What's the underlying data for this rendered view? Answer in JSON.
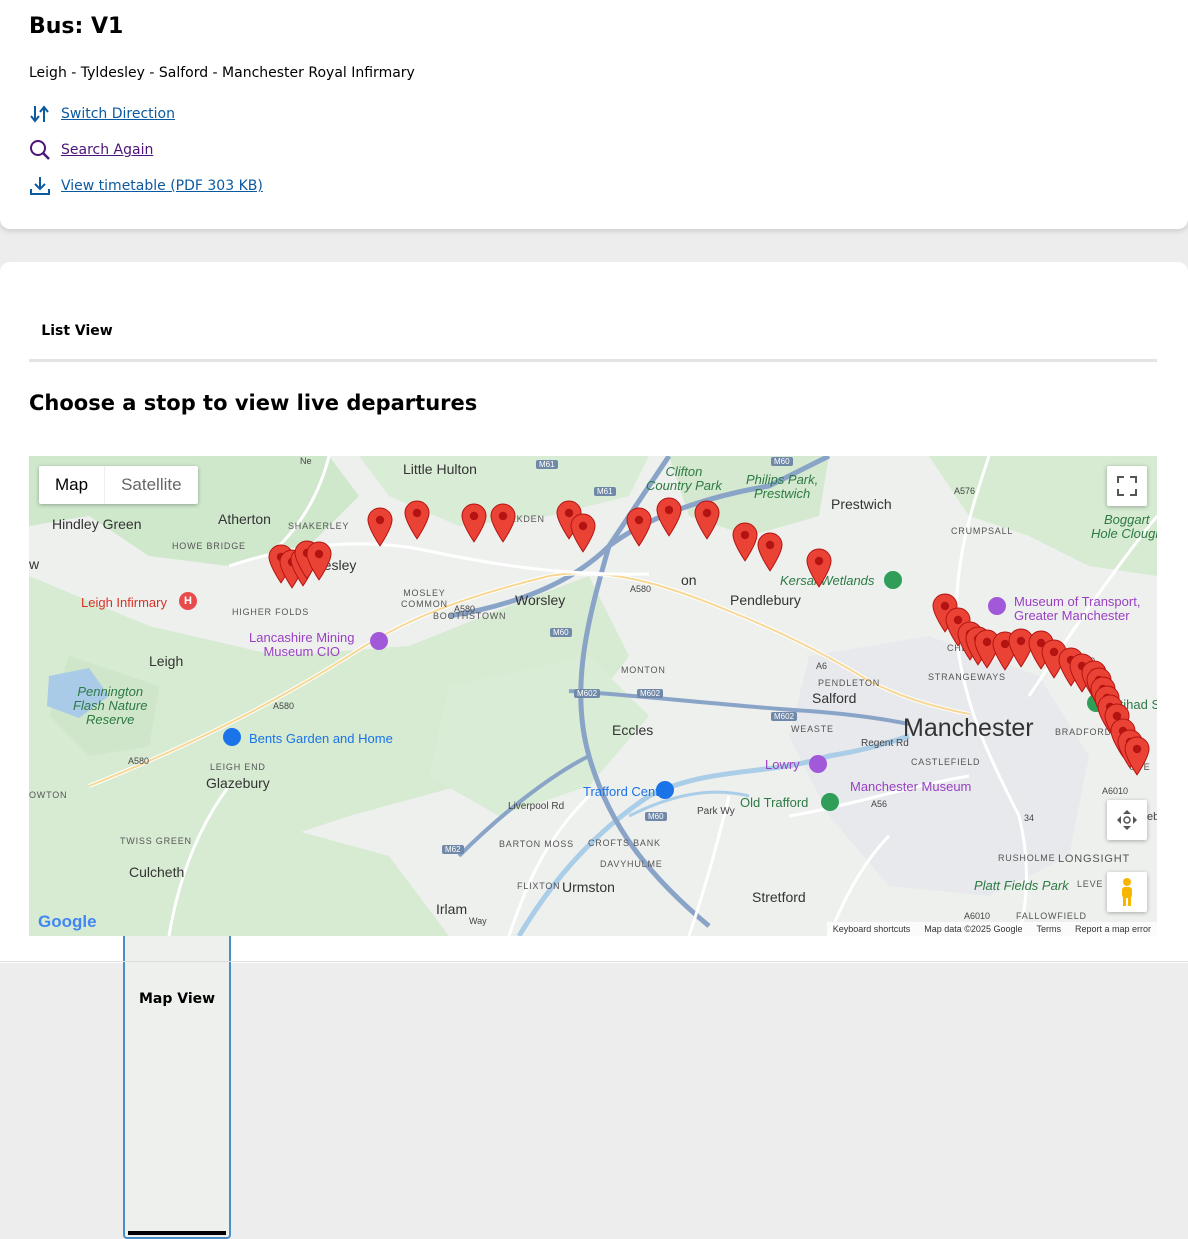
{
  "bus": {
    "title": "Bus: V1",
    "route": "Leigh - Tyldesley - Salford - Manchester Royal Infirmary"
  },
  "actions": {
    "switch": "Switch Direction",
    "search": "Search Again",
    "timetable": "View timetable (PDF 303 KB)"
  },
  "tabs": {
    "list": "List View",
    "map": "Map View",
    "active": "map"
  },
  "heading": "Choose a stop to view live departures",
  "colors": {
    "link": "#0b5aa0",
    "visited": "#4b1478",
    "pin": "#ea4335",
    "tab_focus": "#4a8ec8"
  },
  "map": {
    "type_controls": {
      "map": "Map",
      "satellite": "Satellite",
      "selected": "map"
    },
    "towns": {
      "little_hulton": "Little Hulton",
      "atherton": "Atherton",
      "hindley_green": "Hindley Green",
      "tyldesley": "Tyldesley",
      "worsley": "Worsley",
      "leigh": "Leigh",
      "glazebury": "Glazebury",
      "culcheth": "Culcheth",
      "eccles": "Eccles",
      "salford": "Salford",
      "manchester": "Manchester",
      "prestwich": "Prestwich",
      "pendlebury": "Pendlebury",
      "urmston": "Urmston",
      "irlam": "Irlam",
      "stretford": "Stretford",
      "on": "on",
      "w": "w"
    },
    "districts": {
      "shakerley": "SHAKERLEY",
      "howe_bridge": "HOWE BRIDGE",
      "higher_folds": "HIGHER FOLDS",
      "walkden": "WALKDEN",
      "mosley_common": "MOSLEY\nCOMMON",
      "boothstown": "BOOTHSTOWN",
      "monton": "MONTON",
      "crumpsall": "CRUMPSALL",
      "cheetham_hill": "CHEETHAM HILL",
      "strangeways": "STRANGEWAYS",
      "pendleton": "PENDLETON",
      "weaste": "WEASTE",
      "castlefield": "CASTLEFIELD",
      "bradford": "BRADFORD",
      "leigh_end": "LEIGH END",
      "twiss_green": "TWISS GREEN",
      "barton_moss": "BARTON MOSS",
      "crofts_bank": "CROFTS BANK",
      "davyhulme": "DAVYHULME",
      "flixton": "FLIXTON",
      "rusholme": "RUSHOLME",
      "longsight": "LONGSIGHT",
      "fallowfield": "FALLOWFIELD",
      "ope": "OPE",
      "owton": "OWTON",
      "leve": "LEVE"
    },
    "parks": {
      "clifton": "Clifton\nCountry Park",
      "philips": "Philips Park,\nPrestwich",
      "boggart": "Boggart\nHole Clough",
      "kersal": "Kersal Wetlands",
      "pennington": "Pennington\nFlash Nature\nReserve",
      "platt": "Platt Fields Park"
    },
    "pois": {
      "leigh_infirmary": "Leigh Infirmary",
      "lancashire_mining": "Lancashire Mining\nMuseum CIO",
      "museum_transport": "Museum of Transport,\nGreater Manchester",
      "bents": "Bents Garden and Home",
      "trafford_centre": "Trafford Centre",
      "lowry": "Lowry",
      "old_trafford": "Old Trafford",
      "manchester_museum": "Manchester Museum",
      "etihad": "Etihad S"
    },
    "roads": {
      "m61a": "M61",
      "m61b": "M61",
      "m60a": "M60",
      "m60b": "M60",
      "m60c": "M60",
      "m602a": "M602",
      "m602b": "M602",
      "m602c": "M602",
      "m62": "M62",
      "a580a": "A580",
      "a580b": "A580",
      "a580c": "A580",
      "a580d": "A580",
      "a6": "A6",
      "a56": "A56",
      "a6010a": "A6010",
      "a6010b": "A6010",
      "a576": "A576",
      "a6010c": "A6010",
      "liverpool_rd": "Liverpool Rd",
      "park_way": "Park Wy",
      "regent_rd": "Regent Rd",
      "ne": "Ne",
      "way": "Way",
      "b34": "34",
      "eb": "eb"
    },
    "attribution": {
      "shortcuts": "Keyboard shortcuts",
      "data": "Map data ©2025 Google",
      "terms": "Terms",
      "report": "Report a map error"
    },
    "logo": "Google",
    "stops": [
      {
        "lat": 53.4994,
        "lng": -2.5187
      },
      {
        "lat": 53.4978,
        "lng": -2.5145
      },
      {
        "lat": 53.4986,
        "lng": -2.51
      },
      {
        "lat": 53.5006,
        "lng": -2.5086
      },
      {
        "lat": 53.5001,
        "lng": -2.5039
      },
      {
        "lat": 53.5098,
        "lng": -2.4796
      },
      {
        "lat": 53.5119,
        "lng": -2.4654
      },
      {
        "lat": 53.5112,
        "lng": -2.4428
      },
      {
        "lat": 53.5112,
        "lng": -2.4313
      },
      {
        "lat": 53.512,
        "lng": -2.4053
      },
      {
        "lat": 53.5082,
        "lng": -2.3998
      },
      {
        "lat": 53.5099,
        "lng": -2.378
      },
      {
        "lat": 53.5127,
        "lng": -2.3661
      },
      {
        "lat": 53.5118,
        "lng": -2.3512
      },
      {
        "lat": 53.5055,
        "lng": -2.3364
      },
      {
        "lat": 53.5028,
        "lng": -2.3263
      },
      {
        "lat": 53.4981,
        "lng": -2.3072
      },
      {
        "lat": 53.4853,
        "lng": -2.2574
      },
      {
        "lat": 53.4814,
        "lng": -2.2525
      },
      {
        "lat": 53.4774,
        "lng": -2.2478
      },
      {
        "lat": 53.4759,
        "lng": -2.2447
      },
      {
        "lat": 53.475,
        "lng": -2.241
      },
      {
        "lat": 53.4743,
        "lng": -2.234
      },
      {
        "lat": 53.4752,
        "lng": -2.2275
      },
      {
        "lat": 53.4746,
        "lng": -2.2198
      },
      {
        "lat": 53.4722,
        "lng": -2.2146
      },
      {
        "lat": 53.4699,
        "lng": -2.208
      },
      {
        "lat": 53.4681,
        "lng": -2.2037
      },
      {
        "lat": 53.466,
        "lng": -2.199
      },
      {
        "lat": 53.464,
        "lng": -2.197
      },
      {
        "lat": 53.4615,
        "lng": -2.1955
      },
      {
        "lat": 53.459,
        "lng": -2.194
      },
      {
        "lat": 53.4565,
        "lng": -2.1925
      },
      {
        "lat": 53.4537,
        "lng": -2.1901
      },
      {
        "lat": 53.4495,
        "lng": -2.1874
      },
      {
        "lat": 53.4464,
        "lng": -2.1848
      },
      {
        "lat": 53.4444,
        "lng": -2.1821
      }
    ]
  }
}
